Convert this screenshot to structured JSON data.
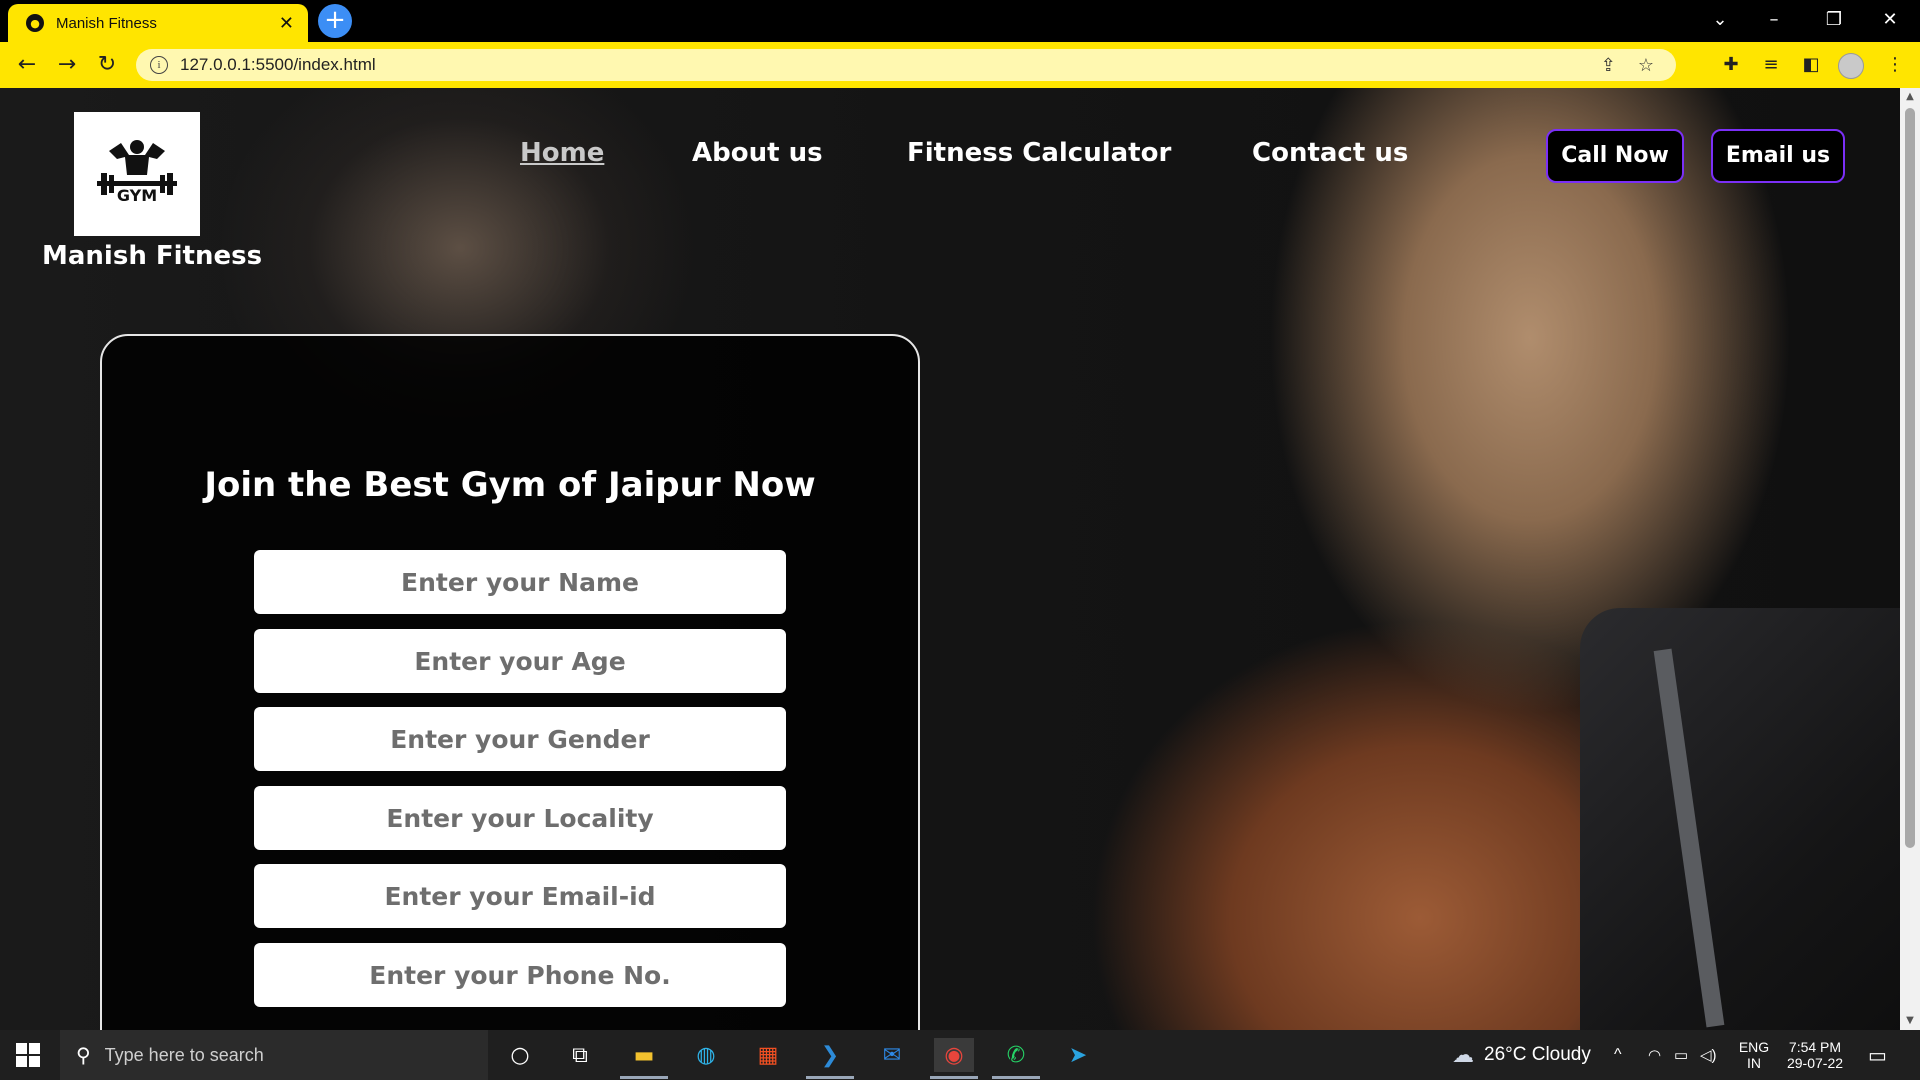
{
  "browser": {
    "tab_title": "Manish Fitness",
    "url": "127.0.0.1:5500/index.html"
  },
  "site": {
    "brand": "Manish Fitness",
    "logo_text": "GYM",
    "nav": [
      {
        "label": "Home",
        "active": true
      },
      {
        "label": "About us",
        "active": false
      },
      {
        "label": "Fitness Calculator",
        "active": false
      },
      {
        "label": "Contact us",
        "active": false
      }
    ],
    "cta": {
      "call_label": "Call Now",
      "email_label": "Email us"
    }
  },
  "form": {
    "title": "Join the Best Gym of Jaipur Now",
    "fields": [
      {
        "placeholder": "Enter your Name",
        "value": ""
      },
      {
        "placeholder": "Enter your Age",
        "value": ""
      },
      {
        "placeholder": "Enter your Gender",
        "value": ""
      },
      {
        "placeholder": "Enter your Locality",
        "value": ""
      },
      {
        "placeholder": "Enter your Email-id",
        "value": ""
      },
      {
        "placeholder": "Enter your Phone No.",
        "value": ""
      }
    ]
  },
  "taskbar": {
    "search_placeholder": "Type here to search",
    "weather": "26°C  Cloudy",
    "lang_top": "ENG",
    "lang_bottom": "IN",
    "time": "7:54 PM",
    "date": "29-07-22"
  },
  "colors": {
    "chrome_accent": "#ffe500",
    "cta_border": "#7b2ff7"
  }
}
